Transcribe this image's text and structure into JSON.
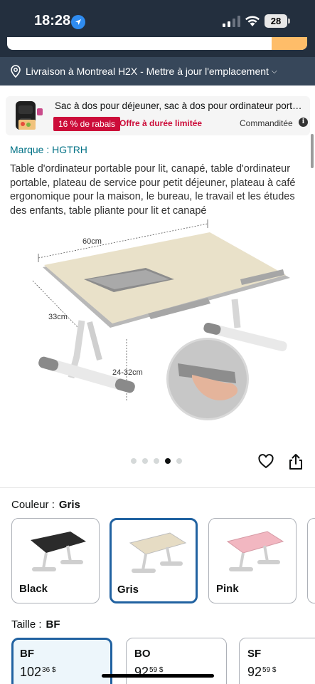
{
  "status_bar": {
    "time": "18:28",
    "battery": "28"
  },
  "delivery": {
    "text": "Livraison à Montreal H2X - Mettre à jour l'emplacement"
  },
  "sponsored_ad": {
    "title": "Sac à dos pour déjeuner, sac à dos pour ordinateur portable de voyage",
    "discount": "16 % de rabais",
    "limited_offer": "Offre à durée limitée",
    "sponsored_label": "Commanditée"
  },
  "product": {
    "brand": "Marque : HGTRH",
    "title": "Table d'ordinateur portable pour lit, canapé, table d'ordinateur portable, plateau de service pour petit déjeuner, plateau à café ergonomique pour la maison, le bureau, le travail et les études des enfants, table pliante pour lit et canapé"
  },
  "image_dims": {
    "width": "60cm",
    "depth": "33cm",
    "height": "24-32cm"
  },
  "gallery": {
    "active_index": 3,
    "count": 5
  },
  "color": {
    "label": "Couleur :",
    "selected": "Gris",
    "options": [
      {
        "label": "Black",
        "hex": "#2b2b2b"
      },
      {
        "label": "Gris",
        "hex": "#e6dcc4"
      },
      {
        "label": "Pink",
        "hex": "#f2b7c1"
      }
    ]
  },
  "size": {
    "label": "Taille :",
    "selected": "BF",
    "options": [
      {
        "name": "BF",
        "price_whole": "102",
        "price_frac": "36 $"
      },
      {
        "name": "BO",
        "price_whole": "92",
        "price_frac": "59 $"
      },
      {
        "name": "SF",
        "price_whole": "92",
        "price_frac": "59 $"
      }
    ]
  },
  "colors": {
    "header": "#232f3e",
    "delivery_bar": "#37475a",
    "accent": "#febd69",
    "link": "#007185",
    "selected_border": "#2162a1",
    "deal": "#cc0c39"
  }
}
